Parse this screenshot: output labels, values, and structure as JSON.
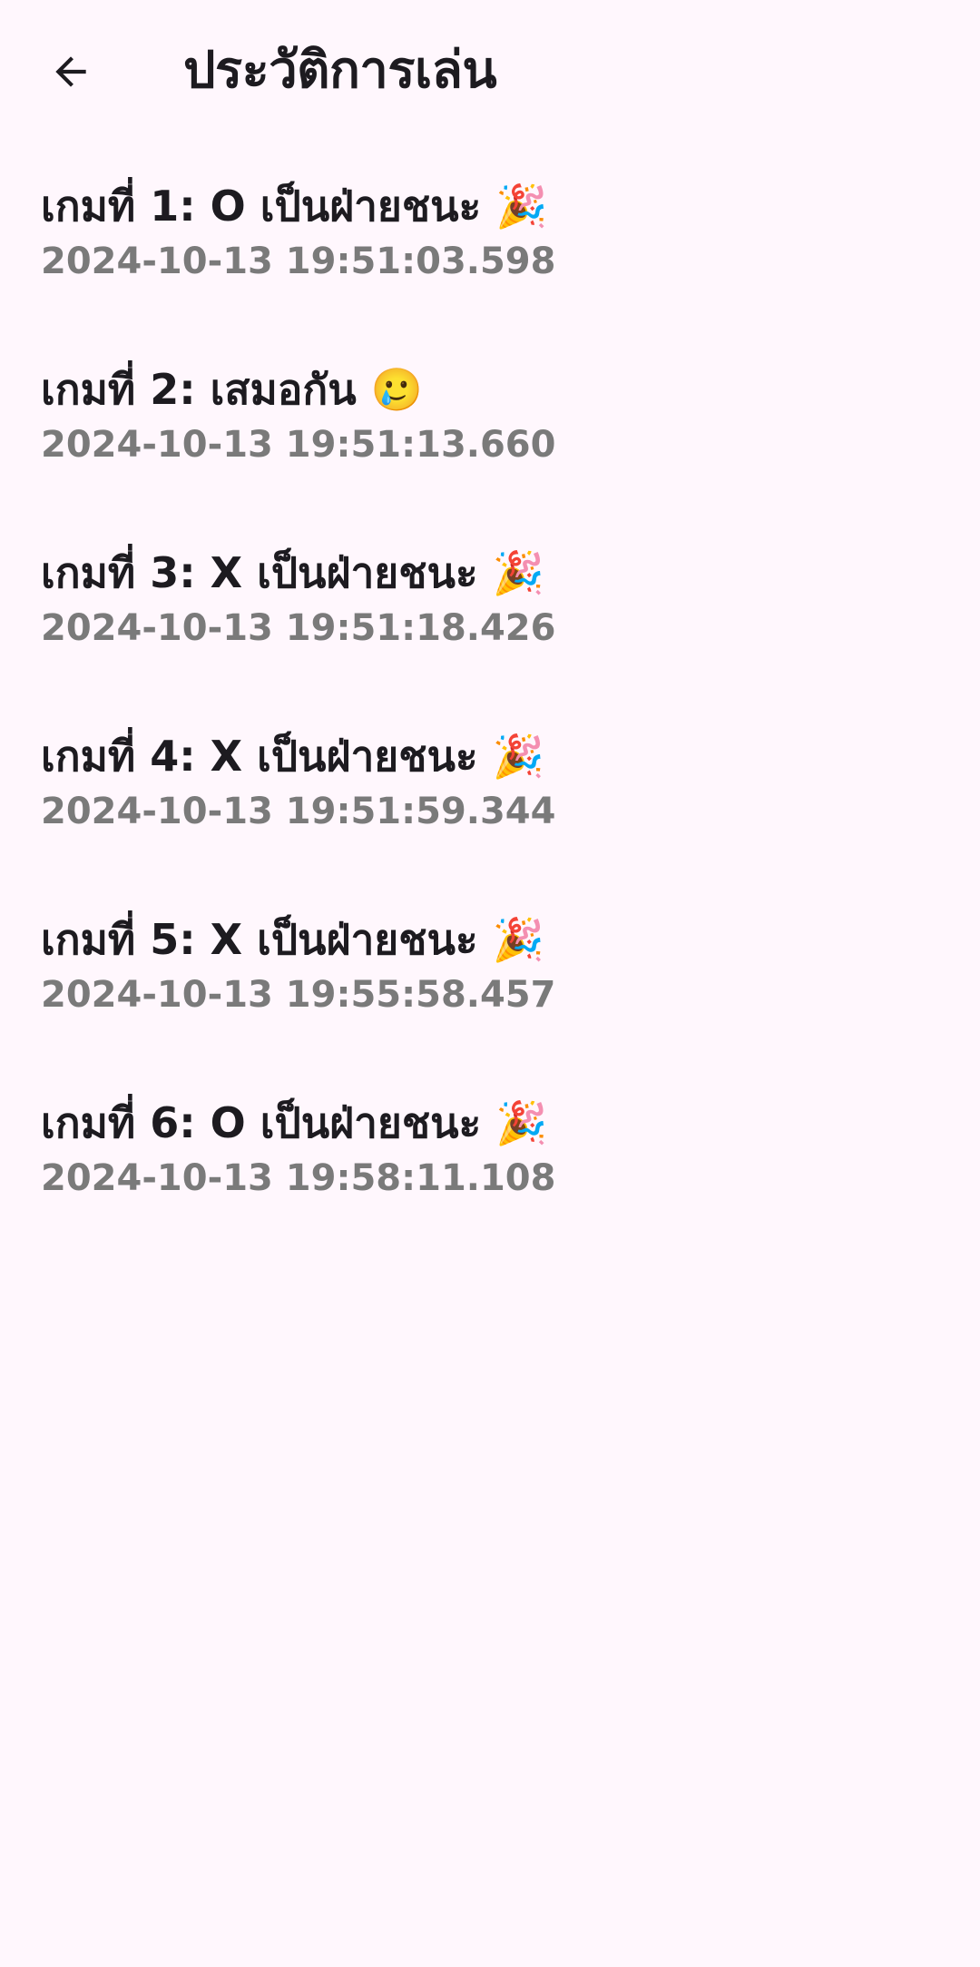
{
  "app_bar": {
    "back_icon": "arrow-back-icon",
    "title": "ประวัติการเล่น"
  },
  "colors": {
    "background": "#FFF7FD",
    "text_primary": "#1D1B20",
    "text_secondary": "#7A7A7A"
  },
  "history": [
    {
      "title": "เกมที่ 1: O เป็นฝ่ายชนะ 🎉",
      "timestamp": "2024-10-13 19:51:03.598"
    },
    {
      "title": "เกมที่ 2: เสมอกัน 🥲",
      "timestamp": "2024-10-13 19:51:13.660"
    },
    {
      "title": "เกมที่ 3: X เป็นฝ่ายชนะ 🎉",
      "timestamp": "2024-10-13 19:51:18.426"
    },
    {
      "title": "เกมที่ 4: X เป็นฝ่ายชนะ 🎉",
      "timestamp": "2024-10-13 19:51:59.344"
    },
    {
      "title": "เกมที่ 5: X เป็นฝ่ายชนะ 🎉",
      "timestamp": "2024-10-13 19:55:58.457"
    },
    {
      "title": "เกมที่ 6: O เป็นฝ่ายชนะ 🎉",
      "timestamp": "2024-10-13 19:58:11.108"
    }
  ]
}
